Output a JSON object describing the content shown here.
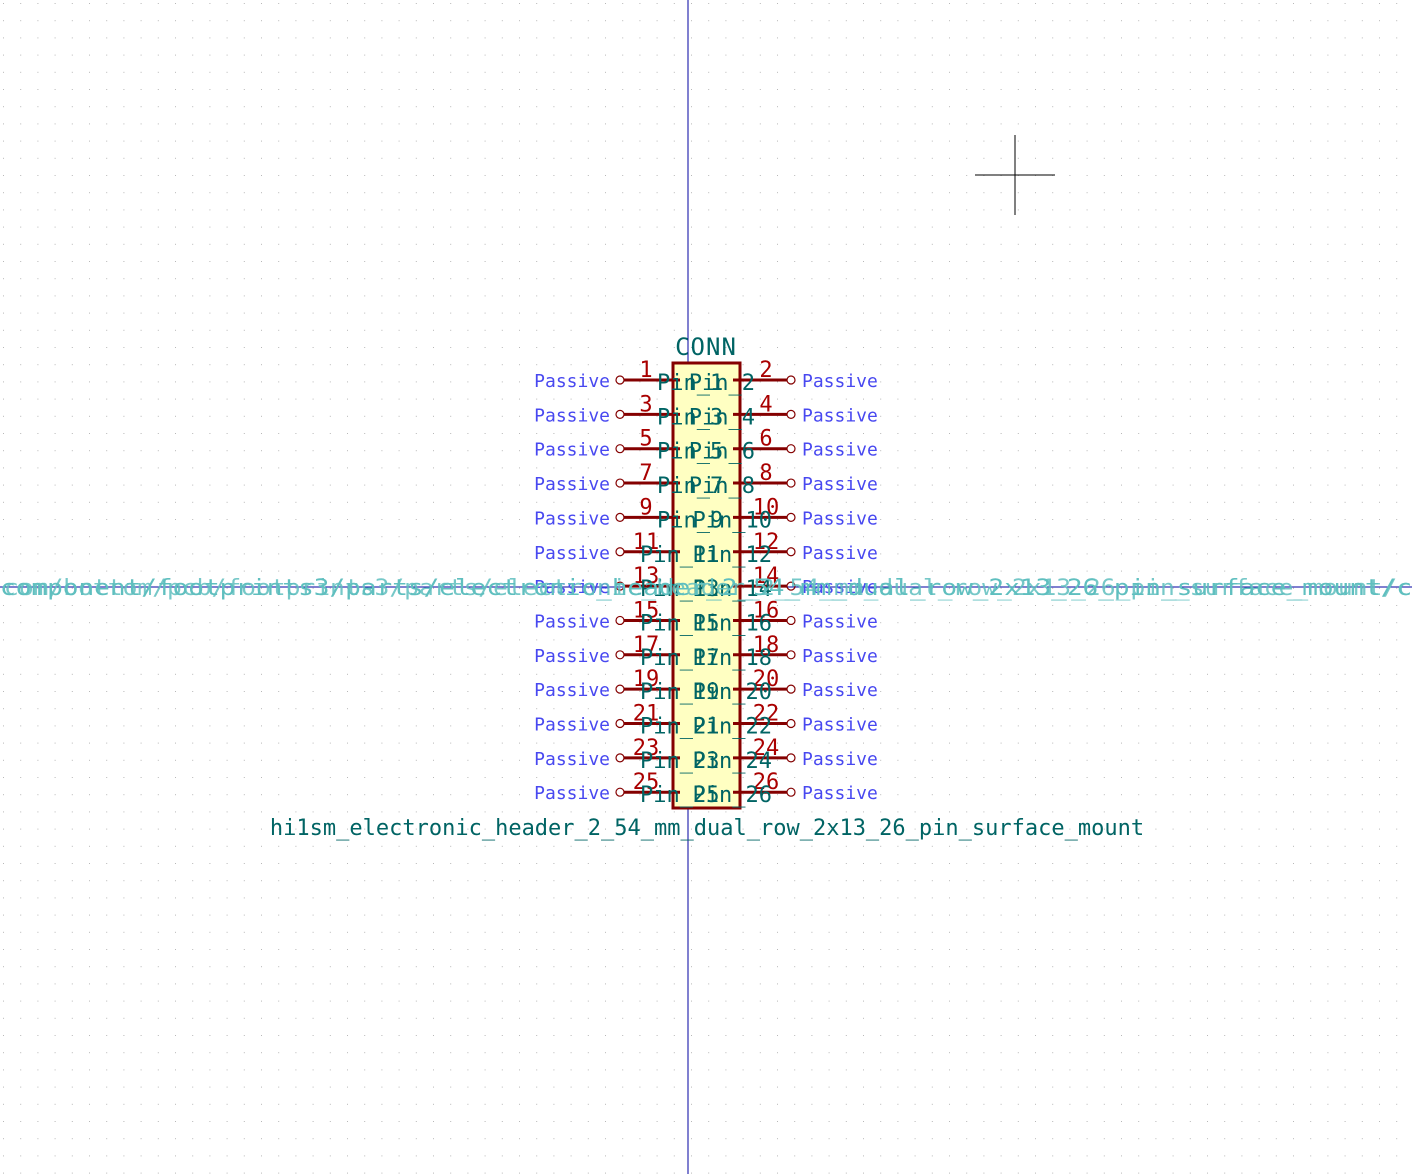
{
  "symbol": {
    "reference": "CONN",
    "value": "hi1sm_electronic_header_2_54_mm_dual_row_2x13_26_pin_surface_mount",
    "footprint_text_a": "component/footprints3/parts/electronic_header_2_54_mm_dual_row_2x13_26_pin_surface_mount/c",
    "footprint_text_b": "com/bottom/pcb/footprints3/parts/electronic_header_2_54_mm_dual_row_2x13_26_pin_surface_mount/c",
    "pin_type": "Passive",
    "pins_left": [
      {
        "number": "1",
        "name": "Pin_1"
      },
      {
        "number": "3",
        "name": "Pin_3"
      },
      {
        "number": "5",
        "name": "Pin_5"
      },
      {
        "number": "7",
        "name": "Pin_7"
      },
      {
        "number": "9",
        "name": "Pin_9"
      },
      {
        "number": "11",
        "name": "Pin_11"
      },
      {
        "number": "13",
        "name": "Pin_13"
      },
      {
        "number": "15",
        "name": "Pin_15"
      },
      {
        "number": "17",
        "name": "Pin_17"
      },
      {
        "number": "19",
        "name": "Pin_19"
      },
      {
        "number": "21",
        "name": "Pin_21"
      },
      {
        "number": "23",
        "name": "Pin_23"
      },
      {
        "number": "25",
        "name": "Pin_25"
      }
    ],
    "pins_right": [
      {
        "number": "2",
        "name": "Pin_2"
      },
      {
        "number": "4",
        "name": "Pin_4"
      },
      {
        "number": "6",
        "name": "Pin_6"
      },
      {
        "number": "8",
        "name": "Pin_8"
      },
      {
        "number": "10",
        "name": "Pin_10"
      },
      {
        "number": "12",
        "name": "Pin_12"
      },
      {
        "number": "14",
        "name": "Pin_14"
      },
      {
        "number": "16",
        "name": "Pin_16"
      },
      {
        "number": "18",
        "name": "Pin_18"
      },
      {
        "number": "20",
        "name": "Pin_20"
      },
      {
        "number": "22",
        "name": "Pin_22"
      },
      {
        "number": "24",
        "name": "Pin_24"
      },
      {
        "number": "26",
        "name": "Pin_26"
      }
    ]
  },
  "colors": {
    "body_fill": "#ffffc2",
    "body_stroke": "#840000",
    "pin": "#840000",
    "pin_number": "#a90000",
    "pin_name": "#006464",
    "pin_type": "#4848f0",
    "field": "#006464",
    "hidden_field": "#5fbfbf",
    "axis": "#0000a0",
    "grid": "#b8b8b8",
    "cursor": "#000000"
  }
}
